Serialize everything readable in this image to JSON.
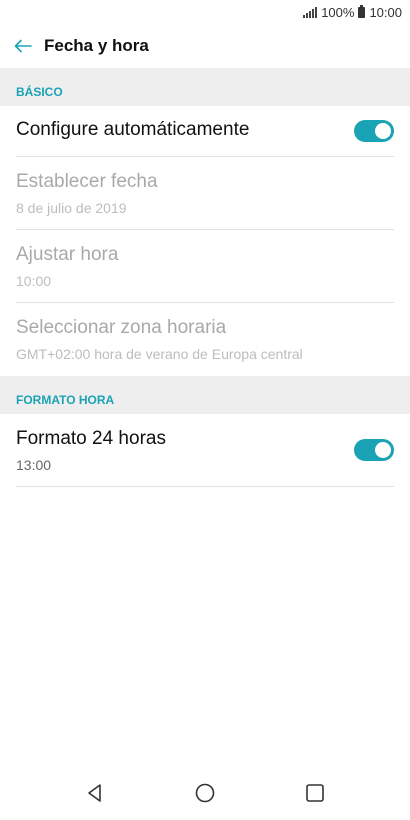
{
  "status_bar": {
    "battery": "100%",
    "time": "10:00"
  },
  "toolbar": {
    "title": "Fecha y hora"
  },
  "sections": {
    "basic": {
      "header": "BÁSICO",
      "auto_config": {
        "title": "Configure automáticamente",
        "enabled": true
      },
      "set_date": {
        "title": "Establecer fecha",
        "value": "8 de julio de 2019"
      },
      "set_time": {
        "title": "Ajustar hora",
        "value": "10:00"
      },
      "timezone": {
        "title": "Seleccionar zona horaria",
        "value": "GMT+02:00 hora de verano de Europa central"
      }
    },
    "time_format": {
      "header": "FORMATO HORA",
      "format_24h": {
        "title": "Formato 24 horas",
        "value": "13:00",
        "enabled": true
      }
    }
  },
  "colors": {
    "accent": "#1aa3b5",
    "section_bg": "#eeeeee"
  },
  "icons": {
    "back": "arrow-left-icon",
    "nav_back": "triangle-back-icon",
    "nav_home": "circle-home-icon",
    "nav_recents": "square-recents-icon"
  }
}
